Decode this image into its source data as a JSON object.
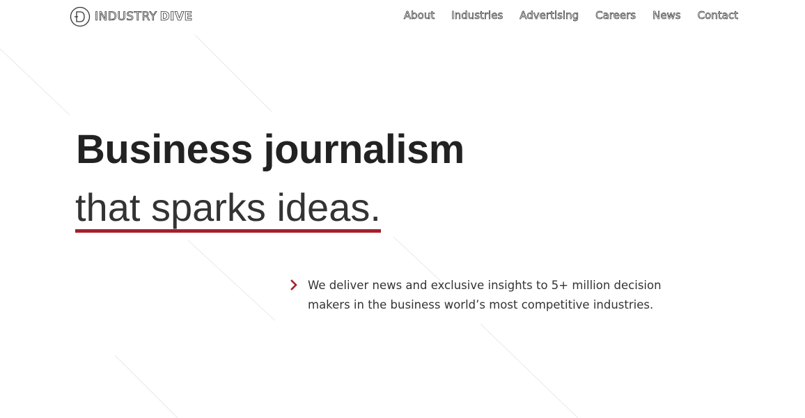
{
  "brand": {
    "name_light": "INDUSTRY",
    "name_bold": "DIVE",
    "logo_icon": "industry-dive-logo-mark"
  },
  "nav": {
    "items": [
      {
        "label": "About"
      },
      {
        "label": "Industries"
      },
      {
        "label": "Advertising"
      },
      {
        "label": "Careers"
      },
      {
        "label": "News"
      },
      {
        "label": "Contact"
      }
    ]
  },
  "hero": {
    "title": "Business journalism",
    "subtitle": "that sparks ideas."
  },
  "intro": {
    "bullet_icon": "chevron-right-icon",
    "line1": "We deliver news and exclusive insights to 5+ million decision",
    "line2": "makers in the business world’s most competitive industries."
  },
  "colors": {
    "accent": "#a61f2b",
    "text": "#222222",
    "background": "#ffffff"
  }
}
